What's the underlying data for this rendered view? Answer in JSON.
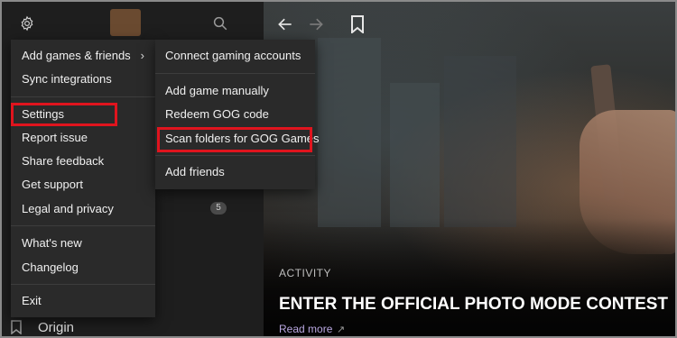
{
  "main_menu": {
    "items": [
      {
        "label": "Add games & friends",
        "has_submenu": true
      },
      {
        "label": "Sync integrations"
      },
      {
        "label": "Settings",
        "highlighted": true
      },
      {
        "label": "Report issue"
      },
      {
        "label": "Share feedback"
      },
      {
        "label": "Get support"
      },
      {
        "label": "Legal and privacy"
      },
      {
        "label": "What's new"
      },
      {
        "label": "Changelog"
      },
      {
        "label": "Exit"
      }
    ]
  },
  "submenu": {
    "items": [
      {
        "label": "Connect gaming accounts"
      },
      {
        "label": "Add game manually"
      },
      {
        "label": "Redeem GOG code"
      },
      {
        "label": "Scan folders for GOG Games",
        "highlighted": true
      },
      {
        "label": "Add friends"
      }
    ]
  },
  "sidebar": {
    "badge_count": "5",
    "origin_label": "Origin"
  },
  "hero": {
    "section_label": "ACTIVITY",
    "headline": "ENTER THE OFFICIAL PHOTO MODE CONTEST",
    "read_more": "Read more"
  },
  "icons": {
    "gear": "gear-icon",
    "search": "search-icon",
    "back": "arrow-left-icon",
    "forward": "arrow-right-icon",
    "bookmark": "bookmark-icon",
    "submenu": "chevron-right-icon",
    "external": "arrow-up-right-icon"
  },
  "colors": {
    "highlight": "#e0141e",
    "menu_bg": "#2a2a2a",
    "link": "#b9a7e0"
  }
}
